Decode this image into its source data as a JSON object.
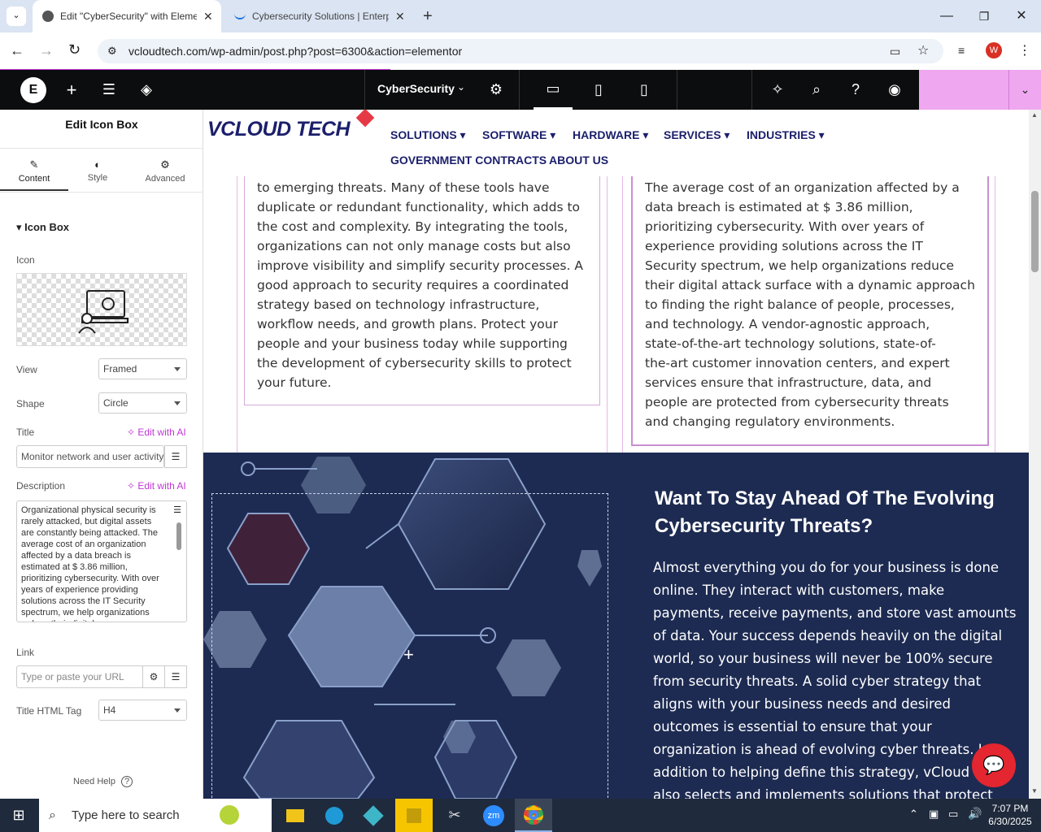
{
  "browser": {
    "tabs": [
      {
        "title": "Edit \"CyberSecurity\" with Eleme",
        "active": true
      },
      {
        "title": "Cybersecurity Solutions | Enterp",
        "active": false
      }
    ],
    "url": "vcloudtech.com/wp-admin/post.php?post=6300&action=elementor",
    "profile_initial": "W"
  },
  "editor_bar": {
    "page_name": "CyberSecurity"
  },
  "panel": {
    "header": "Edit Icon Box",
    "tabs": [
      "Content",
      "Style",
      "Advanced"
    ],
    "section": "Icon Box",
    "icon_label": "Icon",
    "view_label": "View",
    "view_value": "Framed",
    "shape_label": "Shape",
    "shape_value": "Circle",
    "title_label": "Title",
    "edit_ai": "Edit with AI",
    "title_value": "Monitor network and user activity",
    "description_label": "Description",
    "description_value": "Organizational physical security is rarely attacked, but digital assets are constantly being attacked. The average cost of an organization affected by a data breach is estimated at $ 3.86 million, prioritizing cybersecurity. With over years of experience providing solutions across the IT Security spectrum, we help organizations reduce their digital",
    "link_label": "Link",
    "link_placeholder": "Type or paste your URL",
    "html_tag_label": "Title HTML Tag",
    "html_tag_value": "H4",
    "need_help": "Need Help"
  },
  "site": {
    "logo": "VCLOUD TECH",
    "nav": [
      "SOLUTIONS",
      "SOFTWARE",
      "HARDWARE",
      "SERVICES",
      "INDUSTRIES",
      "GOVERNMENT CONTRACTS",
      "ABOUT US"
    ],
    "left_box_lines": [
      "to emerging threats. Many of these tools have",
      "duplicate or redundant functionality, which adds to",
      "the cost and complexity. By integrating the tools,",
      "organizations can not only manage costs but also",
      "improve visibility and simplify security processes. A",
      "good approach to security requires a coordinated",
      "strategy based on technology infrastructure,",
      "workflow needs, and growth plans. Protect your",
      "people and your business today while supporting",
      "the development of cybersecurity skills to protect",
      "your future."
    ],
    "right_box_lines": [
      "The average cost of an organization affected by a",
      "data breach is estimated at $ 3.86 million,",
      "prioritizing cybersecurity. With over years of",
      "experience providing solutions across the IT",
      "Security spectrum, we help organizations reduce",
      "their digital attack surface with a dynamic approach",
      "to finding the right balance of people, processes,",
      "and technology. A vendor-agnostic approach,",
      "state-of-the-art technology solutions, state-of-",
      "the-art customer innovation centers, and expert",
      "services ensure that infrastructure, data, and",
      "people are protected from cybersecurity threats",
      "and changing regulatory environments."
    ],
    "cta_heading_1": "Want To Stay Ahead Of The Evolving",
    "cta_heading_2": "Cybersecurity Threats?",
    "cta_lines": [
      "Almost everything you do for your business is done",
      "online. They interact with customers, make",
      "payments, receive payments, and store vast amounts",
      "of data. Your success depends heavily on the digital",
      "world, so your business will never be 100% secure",
      "from security threats. A solid cyber strategy that",
      "aligns with your business needs and desired",
      "outcomes is essential to ensure that your",
      "organization is ahead of evolving cyber threats. In",
      "addition to helping define this strategy, vCloud Tech",
      "also selects and implements solutions that protect"
    ]
  },
  "taskbar": {
    "search_placeholder": "Type here to search",
    "time": "7:07 PM",
    "date": "6/30/2025"
  }
}
